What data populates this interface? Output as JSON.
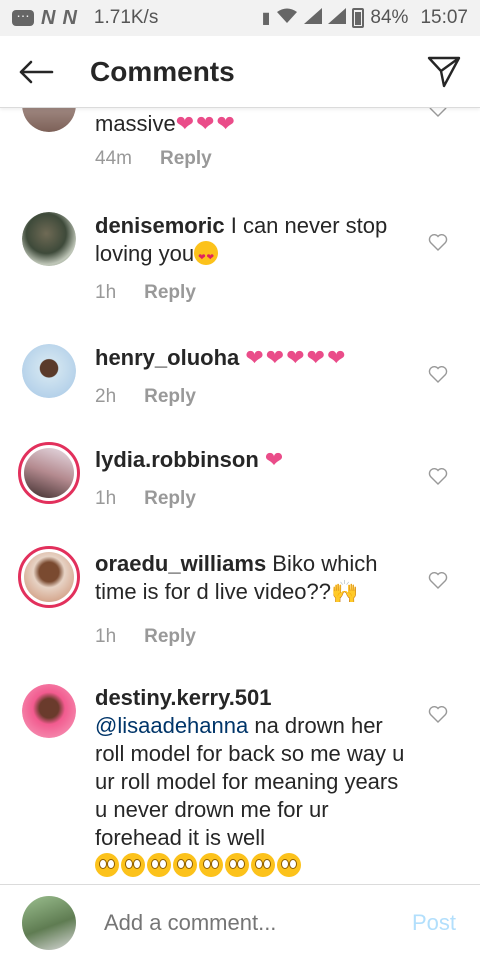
{
  "status": {
    "speed": "1.71K/s",
    "battery": "84%",
    "time": "15:07",
    "network_marks": [
      "N",
      "N"
    ]
  },
  "header": {
    "title": "Comments"
  },
  "comments": [
    {
      "username": "",
      "text": "massive",
      "suffix": "❤❤❤",
      "time": "44m",
      "reply": "Reply"
    },
    {
      "username": "denisemoric",
      "text": " I can never stop loving you",
      "time": "1h",
      "reply": "Reply"
    },
    {
      "username": "henry_oluoha",
      "text": "",
      "suffix": "❤❤❤❤❤",
      "time": "2h",
      "reply": "Reply"
    },
    {
      "username": "lydia.robbinson",
      "text": "",
      "suffix": "❤",
      "time": "1h",
      "reply": "Reply"
    },
    {
      "username": "oraedu_williams",
      "text": " Biko which time is for d live video??",
      "suffix": "🙌",
      "time": "1h",
      "reply": "Reply"
    },
    {
      "username": "destiny.kerry.501",
      "mention": "@lisaadehanna",
      "text": " na drown her roll model for back so me way u ur roll model for meaning years u never drown me for ur forehead it is well"
    }
  ],
  "composer": {
    "placeholder": "Add a comment...",
    "post_label": "Post"
  },
  "colors": {
    "heart": "#ea4c89",
    "story_ring": "#e2305c",
    "post_disabled": "#b2dffc",
    "mention": "#003569"
  }
}
